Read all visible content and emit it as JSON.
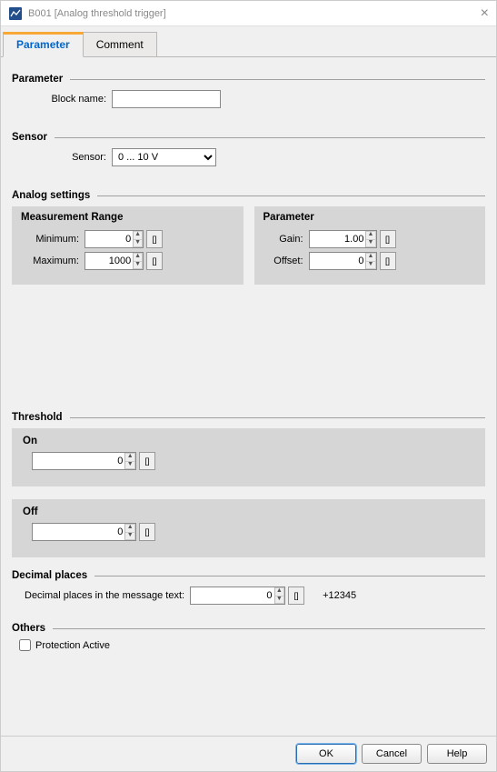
{
  "window": {
    "title": "B001 [Analog threshold trigger]"
  },
  "tabs": {
    "parameter": "Parameter",
    "comment": "Comment"
  },
  "sections": {
    "parameter": "Parameter",
    "sensor": "Sensor",
    "analog": "Analog settings",
    "threshold": "Threshold",
    "decimal": "Decimal places",
    "others": "Others"
  },
  "labels": {
    "block_name": "Block name:",
    "sensor": "Sensor:",
    "measurement_range": "Measurement Range",
    "minimum": "Minimum:",
    "maximum": "Maximum:",
    "param_panel": "Parameter",
    "gain": "Gain:",
    "offset": "Offset:",
    "on": "On",
    "off": "Off",
    "decimal_text": "Decimal places in the message text:",
    "decimal_example": "+12345",
    "protection": "Protection Active"
  },
  "values": {
    "block_name": "",
    "sensor_selected": "0 ... 10 V",
    "minimum": "0",
    "maximum": "1000",
    "gain": "1.00",
    "offset": "0",
    "on": "0",
    "off": "0",
    "decimal": "0",
    "protection_checked": false
  },
  "buttons": {
    "ok": "OK",
    "cancel": "Cancel",
    "help": "Help"
  }
}
